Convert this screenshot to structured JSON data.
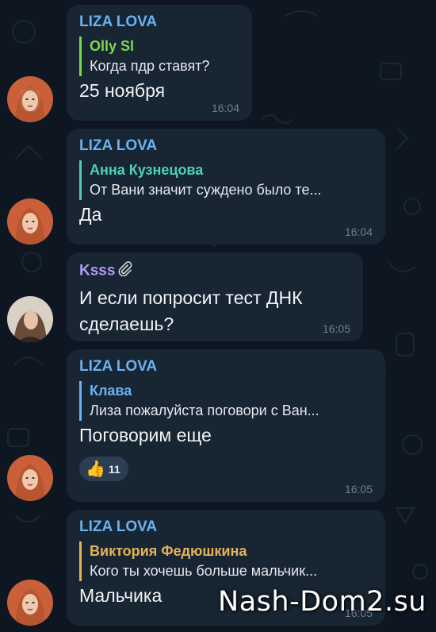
{
  "colors": {
    "background": "#0e1621",
    "bubble": "#182533",
    "sender_blue": "#6ab2f2",
    "sender_purple": "#b49cf5",
    "reply_green": "#7dd84e",
    "reply_teal": "#4fd1b3",
    "reply_blue": "#6ab2f2",
    "reply_orange": "#e3b35a",
    "time": "#6d7f8f"
  },
  "messages": [
    {
      "sender": "LIZA LOVA",
      "reply_name": "Olly Sl",
      "reply_text": "Когда пдр ставят?",
      "text": "25 ноября",
      "time": "16:04"
    },
    {
      "sender": "LIZA LOVA",
      "reply_name": "Анна Кузнецова",
      "reply_text": "От Вани значит суждено было те...",
      "text": "Да",
      "time": "16:04"
    },
    {
      "sender": "Ksss",
      "sender_icon": "paperclip-icon",
      "text_line1": "И если попросит тест ДНК",
      "text_line2": "сделаешь?",
      "time": "16:05"
    },
    {
      "sender": "LIZA LOVA",
      "reply_name": "Клава",
      "reply_text": "Лиза пожалуйста поговори с Ван...",
      "text": "Поговорим еще",
      "reaction": {
        "emoji": "👍",
        "count": "11"
      },
      "time": "16:05"
    },
    {
      "sender": "LIZA LOVA",
      "reply_name": "Виктория Федюшкина",
      "reply_text": "Кого ты хочешь больше мальчик...",
      "text": "Мальчика",
      "time": "16:05"
    }
  ],
  "watermark": "Nash-Dom2.su"
}
